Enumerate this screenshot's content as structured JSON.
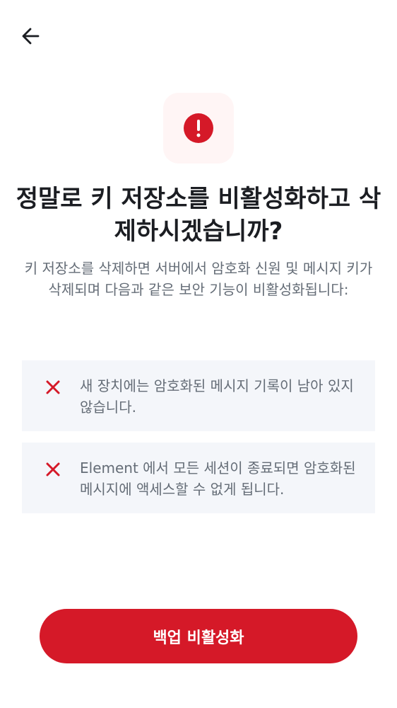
{
  "header": {
    "back_icon": "arrow-left-icon"
  },
  "alert": {
    "icon": "error-circle-icon",
    "accent_color": "#d51928",
    "background_color": "#fff5f5"
  },
  "title": "정말로 키 저장소를 비활성화하고 삭제하시겠습니까?",
  "description": "키 저장소를 삭제하면 서버에서 암호화 신원 및 메시지 키가 삭제되며 다음과 같은 보안 기능이 비활성화됩니다:",
  "consequences": [
    {
      "icon": "close-icon",
      "text": "새 장치에는 암호화된 메시지 기록이 남아 있지 않습니다."
    },
    {
      "icon": "close-icon",
      "text": "Element 에서 모든 세션이 종료되면 암호화된 메시지에 액세스할 수 없게 됩니다."
    }
  ],
  "primary_button": {
    "label": "백업 비활성화",
    "color": "#d51928"
  }
}
